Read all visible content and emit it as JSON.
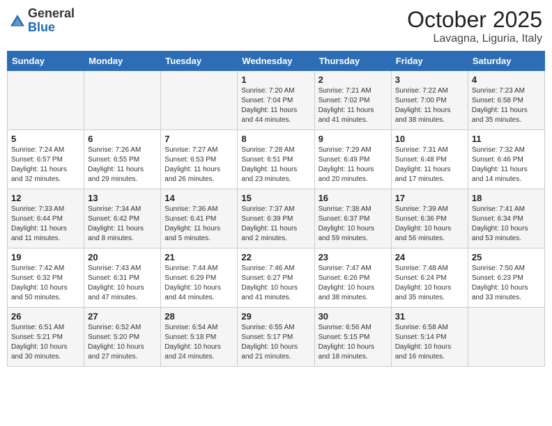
{
  "header": {
    "logo_general": "General",
    "logo_blue": "Blue",
    "title": "October 2025",
    "subtitle": "Lavagna, Liguria, Italy"
  },
  "columns": [
    "Sunday",
    "Monday",
    "Tuesday",
    "Wednesday",
    "Thursday",
    "Friday",
    "Saturday"
  ],
  "weeks": [
    [
      {
        "day": "",
        "info": ""
      },
      {
        "day": "",
        "info": ""
      },
      {
        "day": "",
        "info": ""
      },
      {
        "day": "1",
        "info": "Sunrise: 7:20 AM\nSunset: 7:04 PM\nDaylight: 11 hours\nand 44 minutes."
      },
      {
        "day": "2",
        "info": "Sunrise: 7:21 AM\nSunset: 7:02 PM\nDaylight: 11 hours\nand 41 minutes."
      },
      {
        "day": "3",
        "info": "Sunrise: 7:22 AM\nSunset: 7:00 PM\nDaylight: 11 hours\nand 38 minutes."
      },
      {
        "day": "4",
        "info": "Sunrise: 7:23 AM\nSunset: 6:58 PM\nDaylight: 11 hours\nand 35 minutes."
      }
    ],
    [
      {
        "day": "5",
        "info": "Sunrise: 7:24 AM\nSunset: 6:57 PM\nDaylight: 11 hours\nand 32 minutes."
      },
      {
        "day": "6",
        "info": "Sunrise: 7:26 AM\nSunset: 6:55 PM\nDaylight: 11 hours\nand 29 minutes."
      },
      {
        "day": "7",
        "info": "Sunrise: 7:27 AM\nSunset: 6:53 PM\nDaylight: 11 hours\nand 26 minutes."
      },
      {
        "day": "8",
        "info": "Sunrise: 7:28 AM\nSunset: 6:51 PM\nDaylight: 11 hours\nand 23 minutes."
      },
      {
        "day": "9",
        "info": "Sunrise: 7:29 AM\nSunset: 6:49 PM\nDaylight: 11 hours\nand 20 minutes."
      },
      {
        "day": "10",
        "info": "Sunrise: 7:31 AM\nSunset: 6:48 PM\nDaylight: 11 hours\nand 17 minutes."
      },
      {
        "day": "11",
        "info": "Sunrise: 7:32 AM\nSunset: 6:46 PM\nDaylight: 11 hours\nand 14 minutes."
      }
    ],
    [
      {
        "day": "12",
        "info": "Sunrise: 7:33 AM\nSunset: 6:44 PM\nDaylight: 11 hours\nand 11 minutes."
      },
      {
        "day": "13",
        "info": "Sunrise: 7:34 AM\nSunset: 6:42 PM\nDaylight: 11 hours\nand 8 minutes."
      },
      {
        "day": "14",
        "info": "Sunrise: 7:36 AM\nSunset: 6:41 PM\nDaylight: 11 hours\nand 5 minutes."
      },
      {
        "day": "15",
        "info": "Sunrise: 7:37 AM\nSunset: 6:39 PM\nDaylight: 11 hours\nand 2 minutes."
      },
      {
        "day": "16",
        "info": "Sunrise: 7:38 AM\nSunset: 6:37 PM\nDaylight: 10 hours\nand 59 minutes."
      },
      {
        "day": "17",
        "info": "Sunrise: 7:39 AM\nSunset: 6:36 PM\nDaylight: 10 hours\nand 56 minutes."
      },
      {
        "day": "18",
        "info": "Sunrise: 7:41 AM\nSunset: 6:34 PM\nDaylight: 10 hours\nand 53 minutes."
      }
    ],
    [
      {
        "day": "19",
        "info": "Sunrise: 7:42 AM\nSunset: 6:32 PM\nDaylight: 10 hours\nand 50 minutes."
      },
      {
        "day": "20",
        "info": "Sunrise: 7:43 AM\nSunset: 6:31 PM\nDaylight: 10 hours\nand 47 minutes."
      },
      {
        "day": "21",
        "info": "Sunrise: 7:44 AM\nSunset: 6:29 PM\nDaylight: 10 hours\nand 44 minutes."
      },
      {
        "day": "22",
        "info": "Sunrise: 7:46 AM\nSunset: 6:27 PM\nDaylight: 10 hours\nand 41 minutes."
      },
      {
        "day": "23",
        "info": "Sunrise: 7:47 AM\nSunset: 6:26 PM\nDaylight: 10 hours\nand 38 minutes."
      },
      {
        "day": "24",
        "info": "Sunrise: 7:48 AM\nSunset: 6:24 PM\nDaylight: 10 hours\nand 35 minutes."
      },
      {
        "day": "25",
        "info": "Sunrise: 7:50 AM\nSunset: 6:23 PM\nDaylight: 10 hours\nand 33 minutes."
      }
    ],
    [
      {
        "day": "26",
        "info": "Sunrise: 6:51 AM\nSunset: 5:21 PM\nDaylight: 10 hours\nand 30 minutes."
      },
      {
        "day": "27",
        "info": "Sunrise: 6:52 AM\nSunset: 5:20 PM\nDaylight: 10 hours\nand 27 minutes."
      },
      {
        "day": "28",
        "info": "Sunrise: 6:54 AM\nSunset: 5:18 PM\nDaylight: 10 hours\nand 24 minutes."
      },
      {
        "day": "29",
        "info": "Sunrise: 6:55 AM\nSunset: 5:17 PM\nDaylight: 10 hours\nand 21 minutes."
      },
      {
        "day": "30",
        "info": "Sunrise: 6:56 AM\nSunset: 5:15 PM\nDaylight: 10 hours\nand 18 minutes."
      },
      {
        "day": "31",
        "info": "Sunrise: 6:58 AM\nSunset: 5:14 PM\nDaylight: 10 hours\nand 16 minutes."
      },
      {
        "day": "",
        "info": ""
      }
    ]
  ]
}
